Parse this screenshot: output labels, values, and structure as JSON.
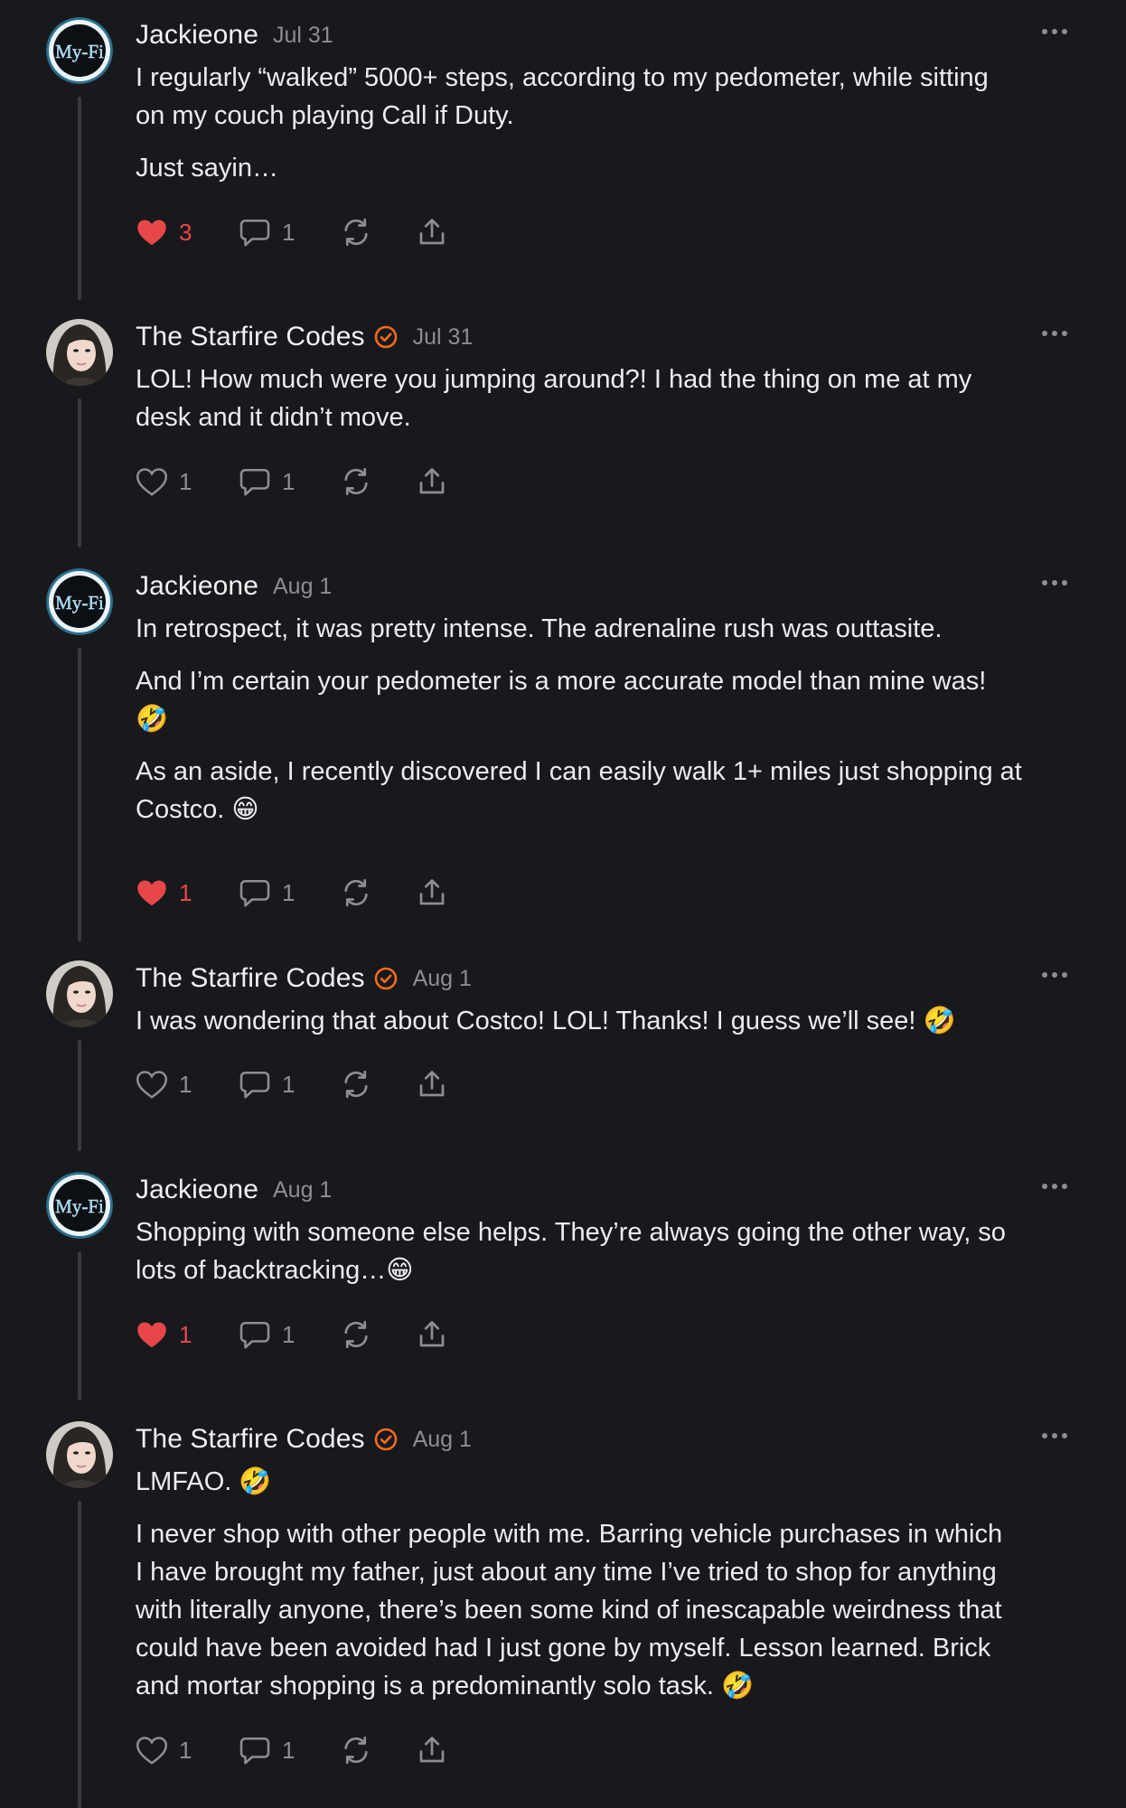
{
  "thread": {
    "comments": [
      {
        "author": "Jackieone",
        "avatar_type": "myfi-logo",
        "avatar_text": "My-Fi",
        "verified": false,
        "date": "Jul 31",
        "paragraphs": [
          "I regularly “walked” 5000+ steps, according to my pedometer, while sitting",
          "on my couch playing Call if Duty.",
          "Just sayin…"
        ],
        "likes": "3",
        "liked": true,
        "replies": "1"
      },
      {
        "author": "The Starfire Codes",
        "avatar_type": "photo-portrait",
        "verified": true,
        "date": "Jul 31",
        "paragraphs": [
          "LOL! How much were you jumping around?! I had the thing on me at my",
          "desk and it didn’t move."
        ],
        "likes": "1",
        "liked": false,
        "replies": "1"
      },
      {
        "author": "Jackieone",
        "avatar_type": "myfi-logo",
        "avatar_text": "My-Fi",
        "verified": false,
        "date": "Aug 1",
        "paragraphs": [
          "In retrospect, it was pretty intense. The adrenaline rush was outtasite.",
          "And I’m certain your pedometer is a more accurate model than mine was!",
          "🤣",
          "As an aside, I recently discovered I can easily walk 1+ miles just shopping at",
          "Costco. 😁"
        ],
        "likes": "1",
        "liked": true,
        "replies": "1"
      },
      {
        "author": "The Starfire Codes",
        "avatar_type": "photo-portrait",
        "verified": true,
        "date": "Aug 1",
        "paragraphs": [
          "I was wondering that about Costco! LOL! Thanks! I guess we’ll see! 🤣"
        ],
        "likes": "1",
        "liked": false,
        "replies": "1"
      },
      {
        "author": "Jackieone",
        "avatar_type": "myfi-logo",
        "avatar_text": "My-Fi",
        "verified": false,
        "date": "Aug 1",
        "paragraphs": [
          "Shopping with someone else helps. They’re always going the other way, so",
          "lots of backtracking…😁"
        ],
        "likes": "1",
        "liked": true,
        "replies": "1"
      },
      {
        "author": "The Starfire Codes",
        "avatar_type": "photo-portrait",
        "verified": true,
        "date": "Aug 1",
        "paragraphs": [
          "LMFAO. 🤣",
          "I never shop with other people with me. Barring vehicle purchases in which",
          "I have brought my father, just about any time I’ve tried to shop for anything",
          "with literally anyone, there’s been some kind of inescapable weirdness that",
          "could have been avoided had I just gone by myself. Lesson learned. Brick",
          "and mortar shopping is a predominantly solo task. 🤣"
        ],
        "likes": "1",
        "liked": false,
        "replies": "1"
      }
    ]
  },
  "colors": {
    "background": "#18191c",
    "text": "#ececef",
    "muted": "#8d8e94",
    "liked_red": "#e8474a",
    "verified_orange": "#f26b1d",
    "thread_line": "#3a3b40"
  }
}
